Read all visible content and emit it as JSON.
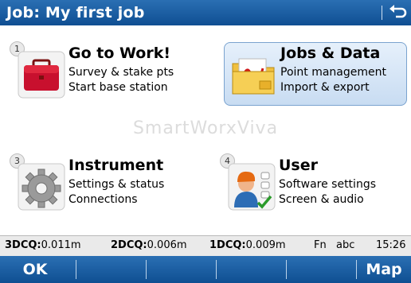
{
  "title_bar": {
    "title": "Job: My first job",
    "back_icon": "back-arrow-icon"
  },
  "menu": [
    {
      "number": "1",
      "title": "Go to Work!",
      "line1": "Survey & stake pts",
      "line2": "Start base station",
      "icon": "briefcase-icon",
      "selected": false
    },
    {
      "number": "",
      "title": "Jobs & Data",
      "line1": "Point management",
      "line2": "Import & export",
      "icon": "folder-data-icon",
      "selected": true
    },
    {
      "number": "3",
      "title": "Instrument",
      "line1": "Settings & status",
      "line2": "Connections",
      "icon": "gear-icon",
      "selected": false
    },
    {
      "number": "4",
      "title": "User",
      "line1": "Software settings",
      "line2": "Screen & audio",
      "icon": "user-settings-icon",
      "selected": false
    }
  ],
  "watermark": "SmartWorxViva",
  "status_bar": {
    "dcq3_label": "3DCQ:",
    "dcq3_value": "0.011m",
    "dcq2_label": "2DCQ:",
    "dcq2_value": "0.006m",
    "dcq1_label": "1DCQ:",
    "dcq1_value": "0.009m",
    "fn": "Fn",
    "input_mode": "abc",
    "time": "15:26"
  },
  "softkeys": {
    "f1": "OK",
    "f6": "Map"
  },
  "colors": {
    "title_bar": "#1c5fa3",
    "selected_tile": "#d6e6f7",
    "status_bar": "#eaeaea"
  }
}
